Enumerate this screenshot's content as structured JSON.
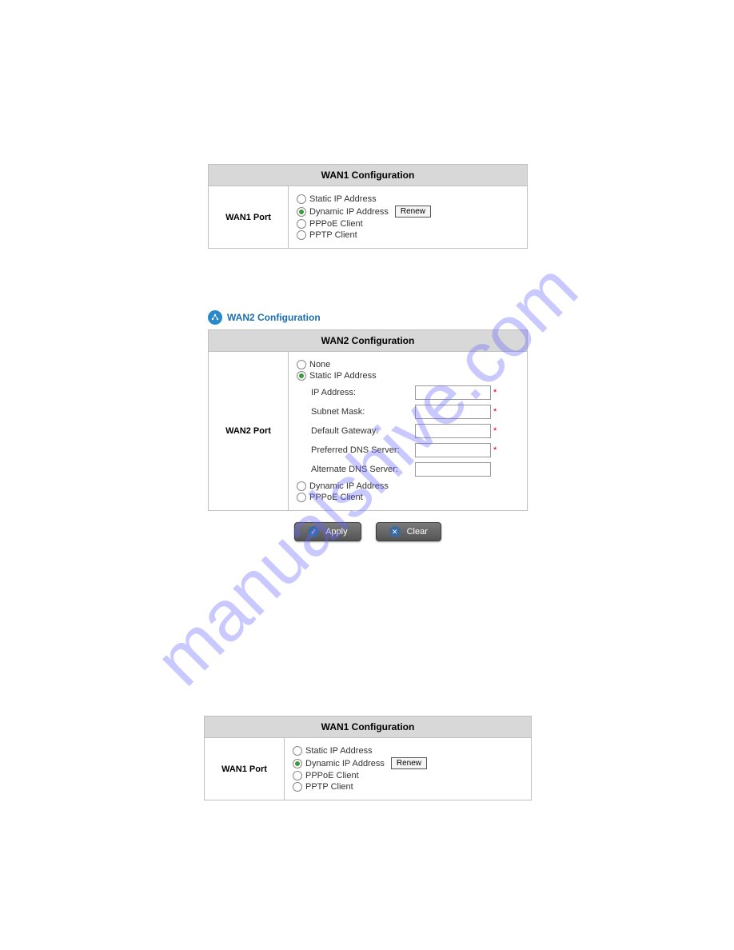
{
  "watermark": "manualshive.com",
  "wan1_top": {
    "header": "WAN1 Configuration",
    "port_label": "WAN1 Port",
    "options": {
      "static": "Static IP Address",
      "dynamic": "Dynamic IP Address",
      "pppoe": "PPPoE Client",
      "pptp": "PPTP Client"
    },
    "renew_btn": "Renew"
  },
  "wan2": {
    "section_title": "WAN2 Configuration",
    "header": "WAN2 Configuration",
    "port_label": "WAN2 Port",
    "options": {
      "none": "None",
      "static": "Static IP Address",
      "dynamic": "Dynamic IP Address",
      "pppoe": "PPPoE Client"
    },
    "fields": {
      "ip": "IP Address:",
      "mask": "Subnet Mask:",
      "gateway": "Default Gateway:",
      "pdns": "Preferred DNS Server:",
      "adns": "Alternate DNS Server:"
    }
  },
  "buttons": {
    "apply": "Apply",
    "clear": "Clear"
  },
  "wan1_bottom": {
    "header": "WAN1 Configuration",
    "port_label": "WAN1 Port",
    "options": {
      "static": "Static IP Address",
      "dynamic": "Dynamic IP Address",
      "pppoe": "PPPoE Client",
      "pptp": "PPTP Client"
    },
    "renew_btn": "Renew"
  }
}
